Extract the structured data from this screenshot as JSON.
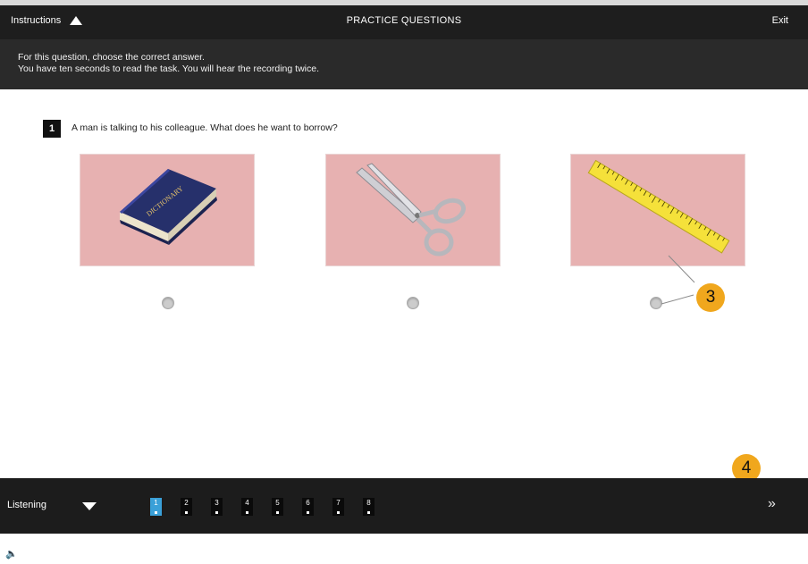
{
  "topbar": {
    "instructions_label": "Instructions",
    "title": "PRACTICE QUESTIONS",
    "exit_label": "Exit"
  },
  "instructions": {
    "line1": "For this question, choose the correct answer.",
    "line2": "You have ten seconds to read the task. You will hear the recording twice."
  },
  "question": {
    "number": "1",
    "text": "A man is talking to his colleague. What does he want to borrow?",
    "options": [
      {
        "name": "dictionary",
        "book_label": "DICTIONARY"
      },
      {
        "name": "scissors"
      },
      {
        "name": "ruler"
      }
    ]
  },
  "callouts": {
    "c3": "3",
    "c4": "4"
  },
  "bottombar": {
    "section_label": "Listening",
    "question_numbers": [
      "1",
      "2",
      "3",
      "4",
      "5",
      "6",
      "7",
      "8"
    ],
    "active_index": 0
  },
  "colors": {
    "bar": "#1e1e1e",
    "image_bg": "#e7b1b1",
    "callout": "#f0a71d",
    "active_nav": "#3aa0d8"
  },
  "icons": {
    "instructions_toggle": "triangle-up-icon",
    "section_toggle": "triangle-down-icon",
    "next": "double-chevron-right-icon",
    "audio": "speaker-icon"
  }
}
